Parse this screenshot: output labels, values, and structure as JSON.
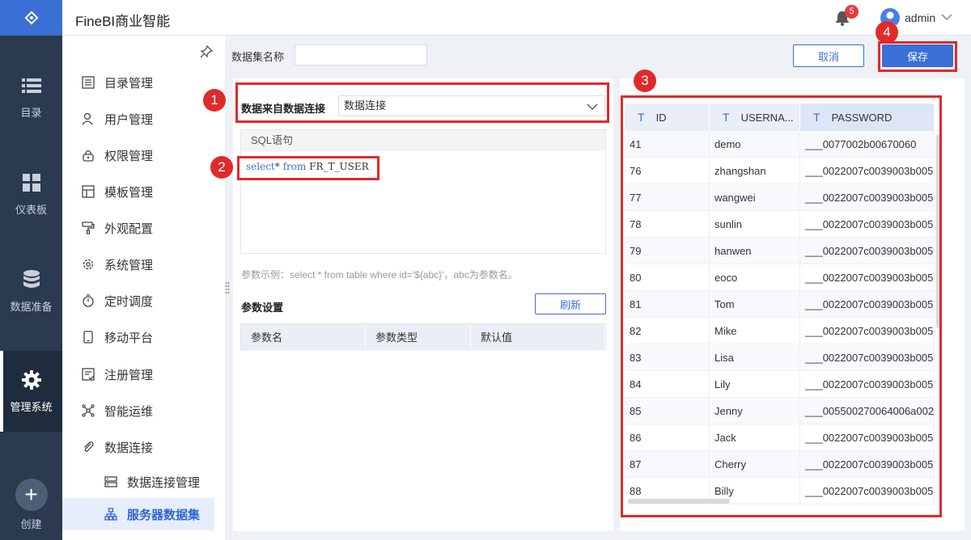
{
  "app": {
    "title": "FineBI商业智能"
  },
  "topbar": {
    "notification_count": "5",
    "username": "admin"
  },
  "leftnav": {
    "items": [
      {
        "label": "目录",
        "icon": "list-icon"
      },
      {
        "label": "仪表板",
        "icon": "dashboard-icon"
      },
      {
        "label": "数据准备",
        "icon": "database-icon"
      },
      {
        "label": "管理系统",
        "icon": "gear-icon",
        "active": true
      }
    ],
    "create_label": "创建"
  },
  "submenu": {
    "items": [
      {
        "label": "目录管理",
        "icon": "catalog-icon"
      },
      {
        "label": "用户管理",
        "icon": "user-icon"
      },
      {
        "label": "权限管理",
        "icon": "lock-icon"
      },
      {
        "label": "模板管理",
        "icon": "template-icon"
      },
      {
        "label": "外观配置",
        "icon": "paint-roller-icon"
      },
      {
        "label": "系统管理",
        "icon": "settings-icon"
      },
      {
        "label": "定时调度",
        "icon": "timer-icon"
      },
      {
        "label": "移动平台",
        "icon": "mobile-icon"
      },
      {
        "label": "注册管理",
        "icon": "register-icon"
      },
      {
        "label": "智能运维",
        "icon": "network-icon"
      },
      {
        "label": "数据连接",
        "icon": "paperclip-icon"
      },
      {
        "label": "数据连接管理",
        "icon": "server-icon",
        "sub": true
      },
      {
        "label": "服务器数据集",
        "icon": "hierarchy-icon",
        "sub": true,
        "selected": true
      }
    ]
  },
  "form": {
    "dataset_name_label": "数据集名称",
    "dataset_name_value": "",
    "cancel_label": "取消",
    "save_label": "保存",
    "source_label": "数据来自数据连接",
    "source_value": "数据连接",
    "sql_header": "SQL语句",
    "sql_kw1": "select",
    "sql_mid": "* ",
    "sql_kw2": "from",
    "sql_table": " FR_T_USER",
    "param_hint": "参数示例：select * from table where id='${abc}'，abc为参数名。",
    "param_title": "参数设置",
    "refresh_label": "刷新",
    "param_columns": [
      "参数名",
      "参数类型",
      "默认值"
    ]
  },
  "preview": {
    "columns": [
      {
        "type": "T",
        "name": "ID"
      },
      {
        "type": "T",
        "name": "USERNA..."
      },
      {
        "type": "T",
        "name": "PASSWORD"
      }
    ],
    "rows": [
      [
        "41",
        "demo",
        "___0077002b00670060"
      ],
      [
        "76",
        "zhangshan",
        "___0022007c0039003b005"
      ],
      [
        "77",
        "wangwei",
        "___0022007c0039003b005"
      ],
      [
        "78",
        "sunlin",
        "___0022007c0039003b005"
      ],
      [
        "79",
        "hanwen",
        "___0022007c0039003b005"
      ],
      [
        "80",
        "eoco",
        "___0022007c0039003b005"
      ],
      [
        "81",
        "Tom",
        "___0022007c0039003b005"
      ],
      [
        "82",
        "Mike",
        "___0022007c0039003b005"
      ],
      [
        "83",
        "Lisa",
        "___0022007c0039003b005"
      ],
      [
        "84",
        "Lily",
        "___0022007c0039003b005"
      ],
      [
        "85",
        "Jenny",
        "___005500270064006a002"
      ],
      [
        "86",
        "Jack",
        "___0022007c0039003b005"
      ],
      [
        "87",
        "Cherry",
        "___0022007c0039003b005"
      ],
      [
        "88",
        "Billy",
        "___0022007c0039003b005"
      ]
    ]
  },
  "annotations": {
    "markers": [
      "1",
      "2",
      "3",
      "4"
    ],
    "color": "#e02a2a"
  },
  "colors": {
    "accent": "#3a6fd6",
    "nav_bg": "#2b3a4f"
  }
}
